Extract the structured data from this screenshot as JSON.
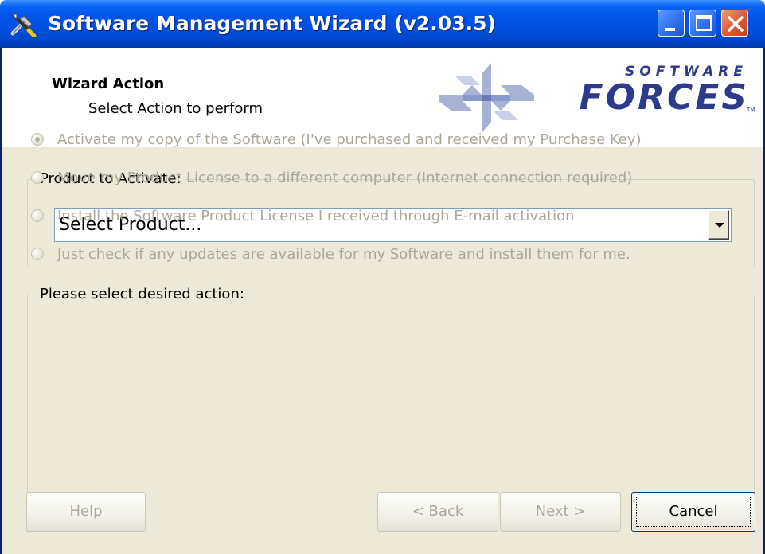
{
  "window": {
    "title": "Software Management Wizard (v2.03.5)",
    "icon": "tools-icon",
    "controls": [
      "minimize-icon",
      "maximize-icon",
      "close-icon"
    ]
  },
  "header": {
    "title": "Wizard Action",
    "subtitle": "Select Action to perform",
    "logo": {
      "line1": "SOFTWARE",
      "line2": "FORCES",
      "tm": "TM"
    }
  },
  "product_group": {
    "legend": "Product to Activate:",
    "combo_value": "Select Product..."
  },
  "action_group": {
    "legend": "Please select desired action:",
    "options": [
      {
        "label": "Activate my copy of the Software (I've purchased and received my Purchase Key)",
        "checked": true,
        "enabled": false
      },
      {
        "label": "Move my Product License to a different computer (Internet connection required)",
        "checked": false,
        "enabled": false
      },
      {
        "label": "Install the Software Product License I received through E-mail activation",
        "checked": false,
        "enabled": false
      },
      {
        "label": "Just check if any updates are available for my Software and install them for me.",
        "checked": false,
        "enabled": false
      }
    ]
  },
  "buttons": {
    "help_m": "H",
    "help_rest": "elp",
    "back_pre": "< ",
    "back_m": "B",
    "back_rest": "ack",
    "next_m": "N",
    "next_rest": "ext >",
    "cancel_m": "C",
    "cancel_rest": "ancel",
    "help_enabled": false,
    "back_enabled": false,
    "next_enabled": false,
    "cancel_enabled": true
  },
  "colors": {
    "titlebar": "#0055ea",
    "face": "#ece9d8",
    "disabled_text": "#aca899",
    "logo": "#2e3a8c"
  }
}
